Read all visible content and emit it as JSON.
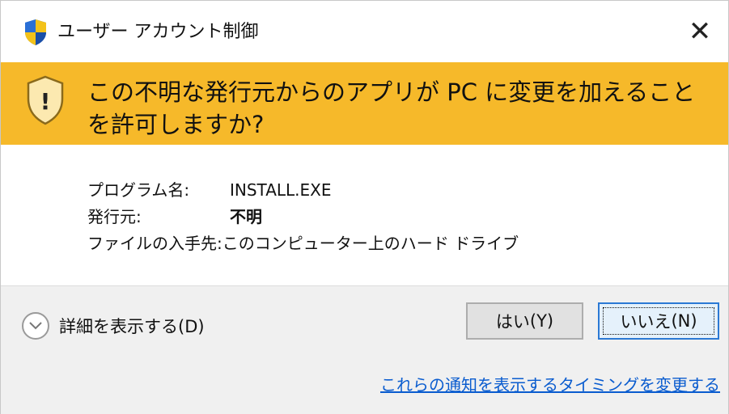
{
  "window": {
    "title": "ユーザー アカウント制御",
    "close_glyph": "✕"
  },
  "banner": {
    "message": "この不明な発行元からのアプリが PC に変更を加えることを許可しますか?",
    "warning_glyph": "!",
    "color": "#f6b92a"
  },
  "details": {
    "program_label": "プログラム名:",
    "program_value": "INSTALL.EXE",
    "publisher_label": "発行元:",
    "publisher_value": "不明",
    "source_label": "ファイルの入手先:",
    "source_value": "このコンピューター上のハード ドライブ"
  },
  "footer": {
    "show_details_label": "詳細を表示する",
    "show_details_key": "(D)",
    "yes_label": "はい",
    "yes_key": "(Y)",
    "no_label": "いいえ",
    "no_key": "(N)",
    "timing_link": "これらの通知を表示するタイミングを変更する",
    "link_color": "#0a5ccf"
  },
  "icons": {
    "title_icon": "uac-shield-icon",
    "banner_icon": "warning-shield-icon",
    "expander_icon": "chevron-down-icon",
    "close_icon": "close-icon"
  }
}
